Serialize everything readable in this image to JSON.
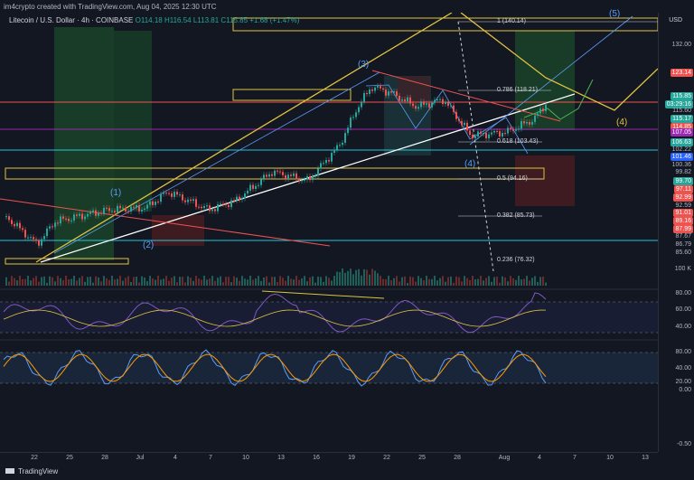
{
  "header": {
    "created_by": "im4crypto created with TradingView.com, Aug 04, 2025 12:30 UTC"
  },
  "symbol": {
    "name": "Litecoin / U.S. Dollar · 4h · COINBASE",
    "ohlc": "O114.18 H116.54 L113.81 C115.85 +1.68 (+1.47%)"
  },
  "axis": {
    "currency": "USD",
    "levels": [
      {
        "text": "132.00",
        "kind": "plain"
      },
      {
        "text": "123.14",
        "kind": "red"
      },
      {
        "text": "115.85",
        "kind": "green"
      },
      {
        "text": "03:29:16",
        "kind": "green-sub"
      },
      {
        "text": "115.60",
        "kind": "plain"
      },
      {
        "text": "115.17",
        "kind": "green"
      },
      {
        "text": "114.85",
        "kind": "red"
      },
      {
        "text": "107.05",
        "kind": "purple"
      },
      {
        "text": "106.63",
        "kind": "green"
      },
      {
        "text": "102.22",
        "kind": "plain"
      },
      {
        "text": "101.46",
        "kind": "blue"
      },
      {
        "text": "100.36",
        "kind": "plain"
      },
      {
        "text": "99.82",
        "kind": "plain"
      },
      {
        "text": "99.70",
        "kind": "green"
      },
      {
        "text": "97.11",
        "kind": "red"
      },
      {
        "text": "92.99",
        "kind": "red"
      },
      {
        "text": "92.59",
        "kind": "plain"
      },
      {
        "text": "91.01",
        "kind": "red"
      },
      {
        "text": "89.16",
        "kind": "red"
      },
      {
        "text": "87.99",
        "kind": "red"
      },
      {
        "text": "87.67",
        "kind": "plain"
      },
      {
        "text": "86.79",
        "kind": "plain"
      },
      {
        "text": "85.60",
        "kind": "plain"
      },
      {
        "text": "100 K",
        "kind": "plain"
      },
      {
        "text": "80.00",
        "kind": "plain"
      },
      {
        "text": "60.00",
        "kind": "plain"
      },
      {
        "text": "40.00",
        "kind": "plain"
      },
      {
        "text": "80.00",
        "kind": "plain"
      },
      {
        "text": "40.00",
        "kind": "plain"
      },
      {
        "text": "20.00",
        "kind": "plain"
      },
      {
        "text": "0.00",
        "kind": "plain"
      },
      {
        "text": "-0.50",
        "kind": "plain"
      }
    ]
  },
  "dates": [
    "22",
    "25",
    "28",
    "Jul",
    "4",
    "7",
    "10",
    "13",
    "16",
    "19",
    "22",
    "25",
    "28",
    "Aug",
    "4",
    "7",
    "10",
    "13"
  ],
  "fib": {
    "f1": "1 (140.14)",
    "f786": "0.786 (118.21)",
    "f618": "0.618 (103.43)",
    "f5": "0.5 (94.16)",
    "f382": "0.382 (85.73)",
    "f236": "0.236 (76.32)"
  },
  "waves": {
    "w1": "(1)",
    "w2": "(2)",
    "w3": "(3)",
    "w4": "(4)",
    "w4b": "(4)",
    "w5": "(5)"
  },
  "footer": {
    "brand": "TradingView"
  },
  "colors": {
    "background": "#131722",
    "up": "#26a69a",
    "down": "#ef5350",
    "fib_yellow": "#e0c341",
    "wave_blue": "#5b9cf6"
  }
}
